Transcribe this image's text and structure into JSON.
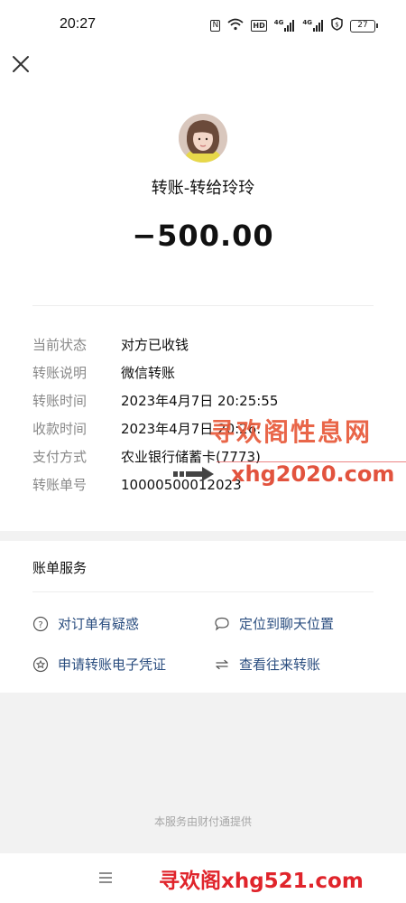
{
  "statusbar": {
    "time": "20:27",
    "icons": [
      "nfc-icon",
      "wifi-icon",
      "hd-icon",
      "signal-4g-1-icon",
      "signal-4g-2-icon",
      "shield-icon"
    ],
    "hd_label": "HD",
    "net1_label": "4G",
    "net2_label": "4G",
    "battery": "27"
  },
  "header": {
    "close_icon": "close-icon"
  },
  "transfer": {
    "title": "转账-转给玲玲",
    "amount": "−500.00"
  },
  "details": [
    {
      "label": "当前状态",
      "value": "对方已收钱"
    },
    {
      "label": "转账说明",
      "value": "微信转账"
    },
    {
      "label": "转账时间",
      "value": "2023年4月7日 20:25:55"
    },
    {
      "label": "收款时间",
      "value": "2023年4月7日 20:26:"
    },
    {
      "label": "支付方式",
      "value": "农业银行储蓄卡(7773)"
    },
    {
      "label": "转账单号",
      "value": "10000500012023"
    }
  ],
  "services": {
    "title": "账单服务",
    "items": [
      {
        "label": "对订单有疑惑",
        "icon": "question-circle-icon"
      },
      {
        "label": "定位到聊天位置",
        "icon": "chat-bubble-icon"
      },
      {
        "label": "申请转账电子凭证",
        "icon": "certificate-icon"
      },
      {
        "label": "查看往来转账",
        "icon": "swap-arrows-icon"
      }
    ]
  },
  "footer": {
    "note": "本服务由财付通提供"
  },
  "watermarks": {
    "line1": "寻欢阁性息网",
    "line2": "xhg2020.com",
    "line3": "寻欢阁xhg521.com"
  },
  "colors": {
    "link": "#2a4d7f",
    "label_grey": "#888888",
    "watermark_red": "#e0452e"
  }
}
